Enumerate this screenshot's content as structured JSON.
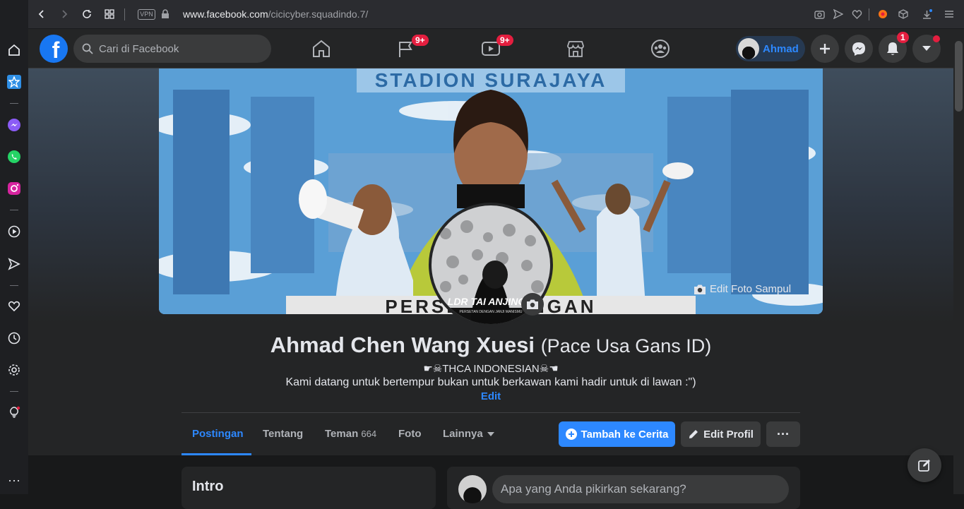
{
  "browser": {
    "url_host": "www.facebook.com",
    "url_path": "/cicicyber.squadindo.7/",
    "vpn_label": "VPN"
  },
  "fb_nav": {
    "search_placeholder": "Cari di Facebook",
    "pages_badge": "9+",
    "watch_badge": "9+",
    "profile_name": "Ahmad",
    "notif_badge": "1"
  },
  "cover": {
    "edit_cover_label": "Edit Foto Sampul",
    "banner_text": "STADION SURAJAYA",
    "bottom_text": "PERSELA SONGAN"
  },
  "avatar": {
    "overlay_title": "LDR TAI ANJING",
    "overlay_sub": "PERSETAN DENGAN JANJI MANISMU"
  },
  "profile": {
    "name": "Ahmad Chen Wang Xuesi",
    "alt_name": "(Pace Usa Gans ID)",
    "subtitle": "☛☠THCA INDONESIAN☠☚",
    "bio": "Kami datang untuk bertempur bukan untuk berkawan kami hadir untuk di lawan :\")",
    "edit_label": "Edit"
  },
  "tabs": {
    "posts": "Postingan",
    "about": "Tentang",
    "friends": "Teman",
    "friends_count": "664",
    "photos": "Foto",
    "more": "Lainnya"
  },
  "actions": {
    "add_story": "Tambah ke Cerita",
    "edit_profile": "Edit Profil",
    "more": "···"
  },
  "intro": {
    "title": "Intro"
  },
  "composer": {
    "placeholder": "Apa yang Anda pikirkan sekarang?"
  },
  "colors": {
    "accent": "#2d88ff",
    "badge": "#e41e3f",
    "brand": "#1877f2"
  }
}
